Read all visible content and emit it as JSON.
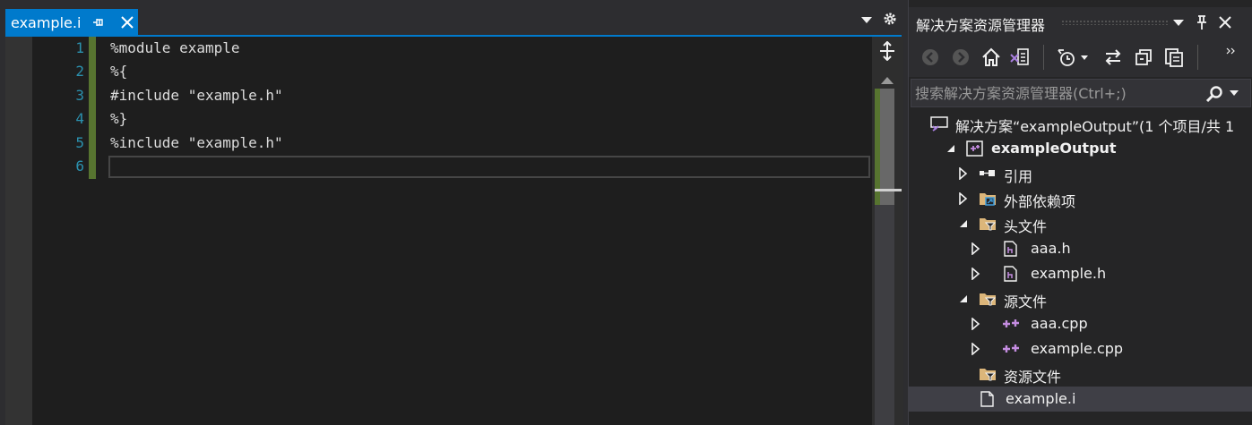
{
  "editor": {
    "tab": {
      "title": "example.i"
    },
    "line_numbers": [
      "1",
      "2",
      "3",
      "4",
      "5",
      "6"
    ],
    "code_lines": [
      "%module example",
      "%{",
      "#include \"example.h\"",
      "%}",
      "%include \"example.h\"",
      ""
    ]
  },
  "solution_explorer": {
    "title": "解决方案资源管理器",
    "search": {
      "placeholder": "搜索解决方案资源管理器(Ctrl+;)"
    },
    "tree": {
      "solution": "解决方案“exampleOutput”(1 个项目/共 1",
      "project": "exampleOutput",
      "references": "引用",
      "external_deps": "外部依赖项",
      "header_files": "头文件",
      "header_items": [
        "aaa.h",
        "example.h"
      ],
      "source_files": "源文件",
      "source_items": [
        "aaa.cpp",
        "example.cpp"
      ],
      "resource_files": "资源文件",
      "extra_file": "example.i"
    }
  },
  "colors": {
    "accent": "#007acc",
    "editor_bg": "#1e1e1e",
    "line_number": "#2b91af",
    "change_bar": "#577430",
    "folder": "#dcb67a"
  }
}
